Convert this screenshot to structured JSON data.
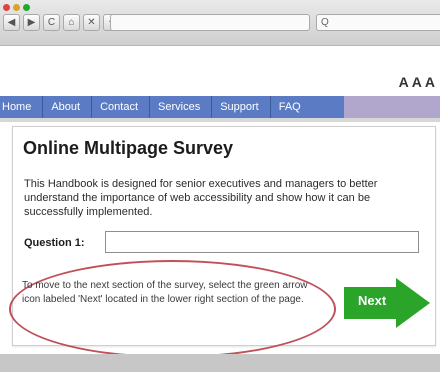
{
  "browser": {
    "nav_buttons": [
      {
        "icon": "back-icon",
        "glyph": "◀"
      },
      {
        "icon": "forward-icon",
        "glyph": "▶"
      },
      {
        "icon": "reload-icon",
        "glyph": "C"
      },
      {
        "icon": "home-icon",
        "glyph": "⌂"
      },
      {
        "icon": "close-icon",
        "glyph": "✕"
      },
      {
        "icon": "new-tab-icon",
        "glyph": "+"
      }
    ],
    "search_glyph": "Q"
  },
  "text_size": [
    "A",
    "A",
    "A"
  ],
  "nav": {
    "items": [
      "Home",
      "About",
      "Contact",
      "Services",
      "Support",
      "FAQ"
    ]
  },
  "survey": {
    "title": "Online Multipage Survey",
    "description": "This Handbook is designed for senior executives and managers to better understand the importance of web accessibility and show how it can be successfully implemented.",
    "question_label": "Question 1:",
    "question_value": "",
    "note": "To move to the next section of the survey, select the green arrow icon labeled 'Next' located in the lower right section of the page.",
    "next_label": "Next"
  },
  "colors": {
    "nav_blue": "#5b7cc4",
    "nav_purple": "#b1a6cc",
    "next_green": "#2aa52a",
    "highlight_ellipse": "#c0505a"
  }
}
